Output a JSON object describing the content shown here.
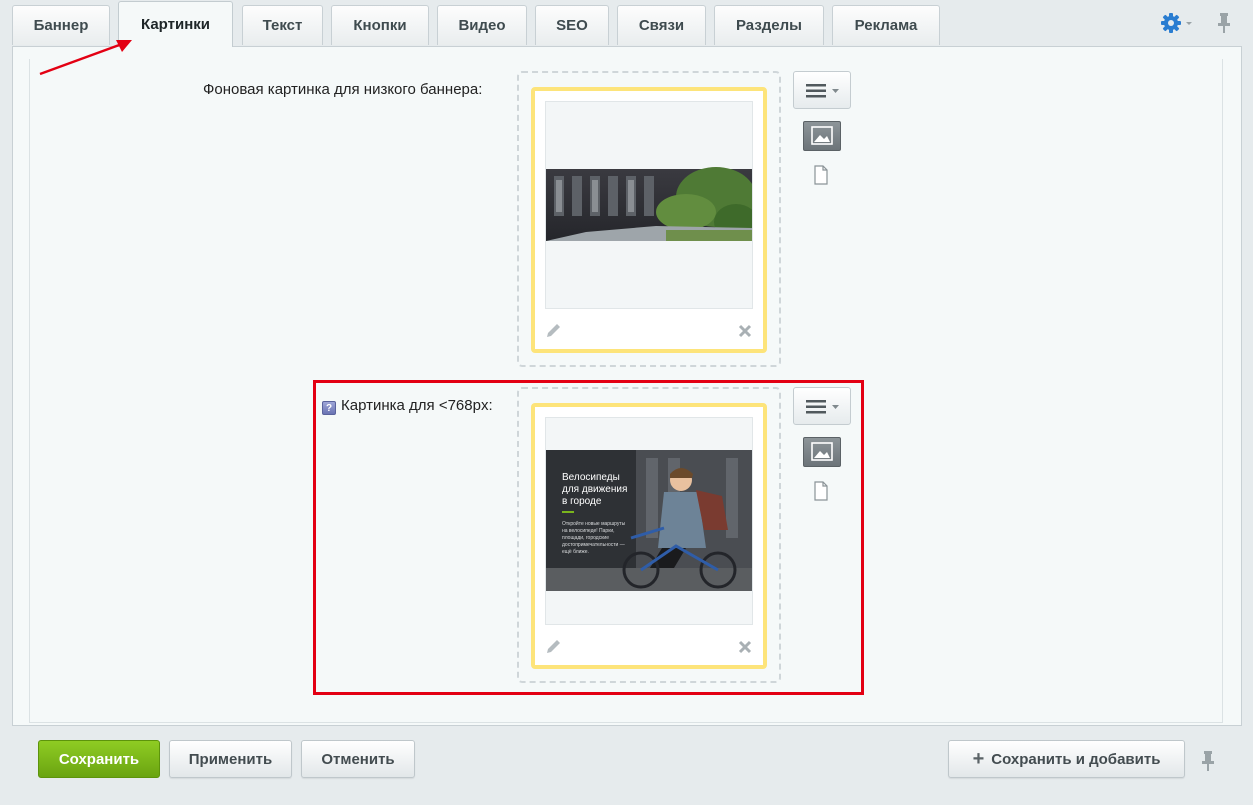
{
  "tabs": [
    {
      "label": "Баннер",
      "active": false
    },
    {
      "label": "Картинки",
      "active": true
    },
    {
      "label": "Текст",
      "active": false
    },
    {
      "label": "Кнопки",
      "active": false
    },
    {
      "label": "Видео",
      "active": false
    },
    {
      "label": "SEO",
      "active": false
    },
    {
      "label": "Связи",
      "active": false
    },
    {
      "label": "Разделы",
      "active": false
    },
    {
      "label": "Реклама",
      "active": false
    }
  ],
  "fields": [
    {
      "label": "Фоновая картинка для низкого баннера:",
      "has_help": false
    },
    {
      "label": "Картинка для <768px:",
      "has_help": true,
      "help_glyph": "?"
    }
  ],
  "preview_text": {
    "title_line1": "Велосипеды",
    "title_line2": "для движения",
    "title_line3": "в городе",
    "body_line1": "Откройте новые маршруты",
    "body_line2": "на велосипеде! Парки,",
    "body_line3": "площади, городские",
    "body_line4": "достопримечательности —",
    "body_line5": "ещё ближе."
  },
  "footer": {
    "save": "Сохранить",
    "apply": "Применить",
    "cancel": "Отменить",
    "save_add": "Сохранить и добавить"
  },
  "colors": {
    "accent_green": "#7ab51d",
    "highlight_red": "#e30013",
    "preview_border_yellow": "#fde47a",
    "gear_blue": "#2a7dd1"
  },
  "icons": {
    "settings": "gear-icon",
    "pin": "pin-icon",
    "edit": "pencil-icon",
    "delete": "close-icon",
    "menu": "hamburger-icon",
    "image": "image-icon",
    "file": "file-icon",
    "add": "plus-icon"
  }
}
